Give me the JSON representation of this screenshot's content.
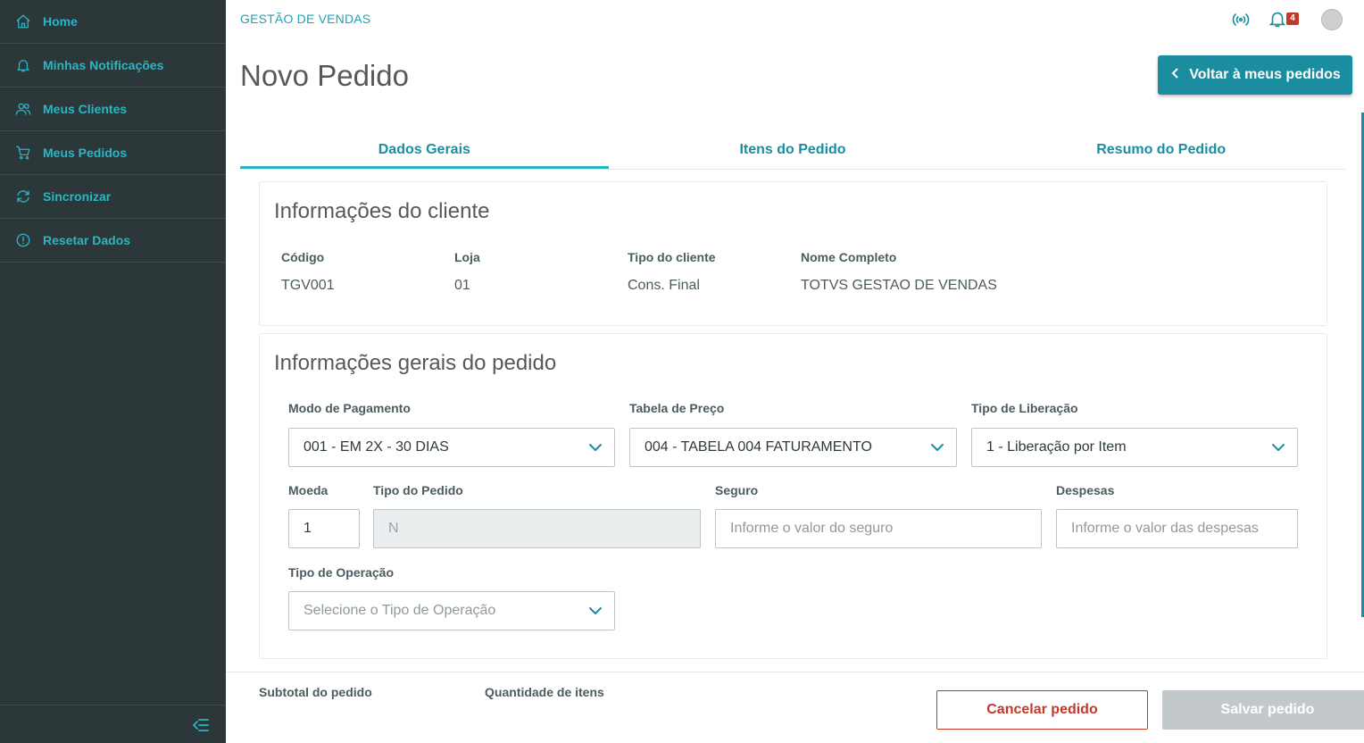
{
  "sidebar": {
    "items": [
      {
        "label": "Home",
        "icon": "home-icon"
      },
      {
        "label": "Minhas Notificações",
        "icon": "bell-icon"
      },
      {
        "label": "Meus Clientes",
        "icon": "users-icon"
      },
      {
        "label": "Meus Pedidos",
        "icon": "cart-icon"
      },
      {
        "label": "Sincronizar",
        "icon": "sync-icon"
      },
      {
        "label": "Resetar Dados",
        "icon": "info-icon"
      }
    ]
  },
  "header": {
    "app_title": "GESTÃO DE VENDAS",
    "notification_count": "4",
    "page_title": "Novo Pedido",
    "back_button_label": "Voltar à meus pedidos"
  },
  "tabs": [
    {
      "label": "Dados Gerais",
      "active": true
    },
    {
      "label": "Itens do Pedido",
      "active": false
    },
    {
      "label": "Resumo do Pedido",
      "active": false
    }
  ],
  "client_info": {
    "title": "Informações do cliente",
    "fields": [
      {
        "label": "Código",
        "value": "TGV001"
      },
      {
        "label": "Loja",
        "value": "01"
      },
      {
        "label": "Tipo do cliente",
        "value": "Cons. Final"
      },
      {
        "label": "Nome Completo",
        "value": "TOTVS GESTAO DE VENDAS"
      }
    ]
  },
  "order_info": {
    "title": "Informações gerais do pedido",
    "payment_mode": {
      "label": "Modo de Pagamento",
      "value": "001 - EM 2X - 30 DIAS"
    },
    "price_table": {
      "label": "Tabela de Preço",
      "value": "004 - TABELA 004 FATURAMENTO"
    },
    "release_type": {
      "label": "Tipo de Liberação",
      "value": "1 - Liberação por Item"
    },
    "currency": {
      "label": "Moeda",
      "value": "1"
    },
    "order_type": {
      "label": "Tipo do Pedido",
      "value": "N"
    },
    "insurance": {
      "label": "Seguro",
      "placeholder": "Informe o valor do seguro"
    },
    "expenses": {
      "label": "Despesas",
      "placeholder": "Informe o valor das despesas"
    },
    "operation_type": {
      "label": "Tipo de Operação",
      "placeholder": "Selecione o Tipo de Operação"
    }
  },
  "footer": {
    "subtotal_label": "Subtotal do pedido",
    "quantity_label": "Quantidade de itens",
    "cancel_label": "Cancelar pedido",
    "save_label": "Salvar pedido"
  },
  "colors": {
    "sidebar_bg": "#2c3739",
    "accent": "#29b6c5",
    "primary": "#1a8ea0",
    "danger": "#c0392b",
    "disabled": "#c3c9ca"
  }
}
